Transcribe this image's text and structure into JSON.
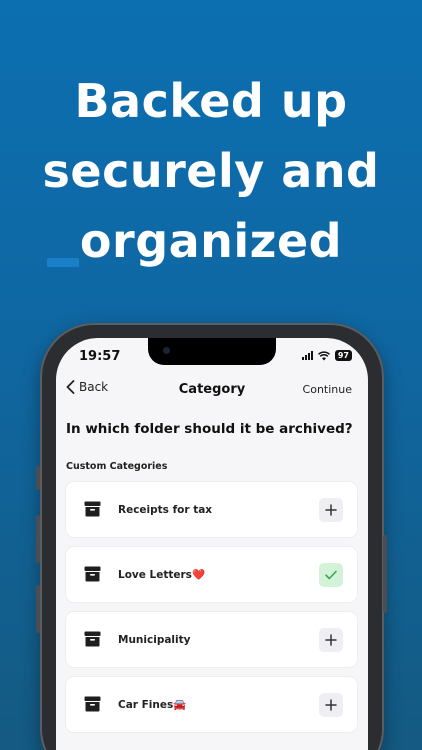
{
  "headline": {
    "line1": "Backed up",
    "line2": "securely and",
    "line3": "organized"
  },
  "status_bar": {
    "time": "19:57",
    "battery": "97"
  },
  "nav": {
    "back_label": "Back",
    "title": "Category",
    "continue_label": "Continue"
  },
  "question": "In which folder should it be archived?",
  "section_label": "Custom Categories",
  "categories": [
    {
      "label": "Receipts for tax",
      "emoji": "",
      "selected": false
    },
    {
      "label": "Love Letters",
      "emoji": "❤️",
      "selected": true
    },
    {
      "label": "Municipality",
      "emoji": "",
      "selected": false
    },
    {
      "label": "Car Fines",
      "emoji": "🚘",
      "selected": false
    }
  ],
  "colors": {
    "background_top": "#0c6fb0",
    "background_bottom": "#145a82",
    "check_bg": "#d3f3d8",
    "check_color": "#3aa55a"
  }
}
